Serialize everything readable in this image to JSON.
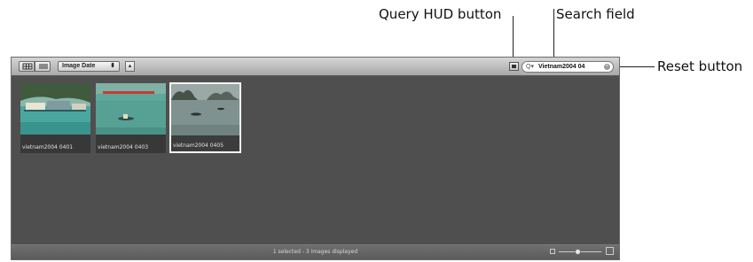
{
  "callouts": {
    "query_hud": "Query HUD button",
    "search_field": "Search field",
    "reset": "Reset button"
  },
  "toolbar": {
    "sort_label": "Image Date",
    "sort_arrows": "⬍",
    "sort_direction": "▲",
    "search_value": "Vietnam2004 04",
    "search_icon": "magnifier-icon",
    "reset_icon": "x-circle-icon"
  },
  "thumbnails": [
    {
      "name": "vietnam2004 0401",
      "selected": false
    },
    {
      "name": "vietnam2004 0403",
      "selected": false
    },
    {
      "name": "vietnam2004 0405",
      "selected": true
    }
  ],
  "status": {
    "text": "1 selected - 3 images displayed",
    "thumb_size_level": 0.45
  },
  "colors": {
    "browser_bg": "#4f4f4f",
    "toolbar": "#c0c0c0",
    "selection": "#f2f2f2"
  }
}
